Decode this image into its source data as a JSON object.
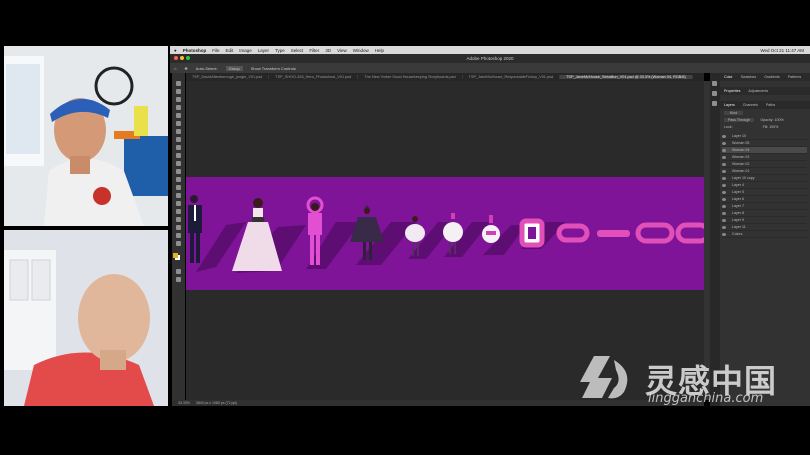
{
  "menubar": {
    "apple": "",
    "items": [
      "Photoshop",
      "File",
      "Edit",
      "Image",
      "Layer",
      "Type",
      "Select",
      "Filter",
      "3D",
      "View",
      "Window",
      "Help"
    ],
    "clock": "Wed Oct 21 11:47 AM"
  },
  "window": {
    "title": "Adobe Photoshop 2020"
  },
  "options": {
    "auto_select": "Auto-Select:",
    "auto_select_value": "Group",
    "show_transform": "Show Transform Controls"
  },
  "tabs": [
    {
      "label": "TSP_DavidAttenborough_jungle_V01.psd",
      "active": false
    },
    {
      "label": "TSP_SHOO-326_Hero_Photoshoot_V01.psd",
      "active": false
    },
    {
      "label": "The New Yorker Good Housekeeping Storyboards.psd",
      "active": false
    },
    {
      "label": "TSP_JaneMcHouse_RespectableFictory_V01.psd",
      "active": false
    },
    {
      "label": "TSP_JaneMcHouse_Seballion_V01.psd @ 33.3% (Woman 04, RGB/8)",
      "active": true
    }
  ],
  "status": {
    "zoom": "33.33%",
    "doc_size": "3840 px x 1080 px (72 ppi)"
  },
  "panels": {
    "top_tabs": [
      "Color",
      "Swatches",
      "Gradients",
      "Patterns"
    ],
    "props_tabs": [
      "Properties",
      "Adjustments"
    ],
    "layer_tabs": [
      "Layers",
      "Channels",
      "Paths"
    ],
    "kind": "Kind",
    "blend": "Pass Through",
    "opacity": "Opacity: 100%",
    "lock": "Lock:",
    "fill": "Fill: 100%",
    "layers": [
      {
        "name": "Layer 10",
        "selected": false
      },
      {
        "name": "Woman 05",
        "selected": false
      },
      {
        "name": "Woman 04",
        "selected": true
      },
      {
        "name": "Woman 03",
        "selected": false
      },
      {
        "name": "Woman 02",
        "selected": false
      },
      {
        "name": "Woman 01",
        "selected": false
      },
      {
        "name": "Layer 10 copy",
        "selected": false
      },
      {
        "name": "Layer 4",
        "selected": false
      },
      {
        "name": "Layer 5",
        "selected": false
      },
      {
        "name": "Layer 6",
        "selected": false
      },
      {
        "name": "Layer 7",
        "selected": false
      },
      {
        "name": "Layer 8",
        "selected": false
      },
      {
        "name": "Layer 9",
        "selected": false
      },
      {
        "name": "Layer 11",
        "selected": false
      },
      {
        "name": "Colors",
        "selected": false
      }
    ]
  },
  "watermark": {
    "cn": "灵感中国",
    "url": "lingganchina.com"
  },
  "colors": {
    "artboard": "#7f1499",
    "accent_pink": "#d03fb8"
  }
}
